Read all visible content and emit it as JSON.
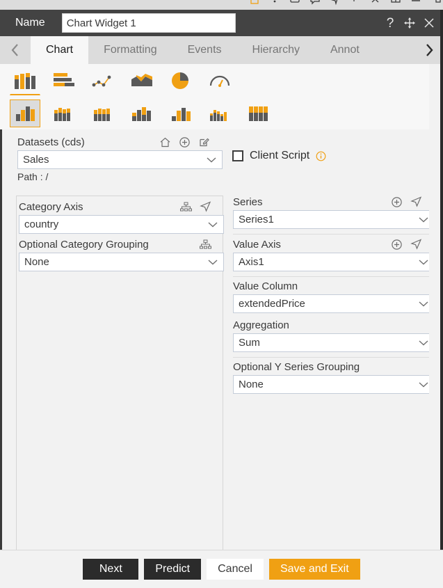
{
  "top_toolbar": {
    "icons": [
      "image-icon",
      "dot-icon",
      "rectangle-icon",
      "callout-icon",
      "arrow-cursor-icon",
      "pointer-icon",
      "scissors-icon",
      "book-icon",
      "lines-icon",
      "panel-icon"
    ]
  },
  "header": {
    "name_label": "Name",
    "name_value": "Chart Widget 1",
    "help_label": "?",
    "move_icon": "move-icon",
    "close_icon": "close-icon"
  },
  "tabbar": {
    "prev_icon": "chevron-left-icon",
    "next_icon": "chevron-right-icon",
    "tabs": [
      {
        "label": "Chart",
        "active": true
      },
      {
        "label": "Formatting",
        "active": false
      },
      {
        "label": "Events",
        "active": false
      },
      {
        "label": "Hierarchy",
        "active": false
      },
      {
        "label": "Annot",
        "active": false
      }
    ]
  },
  "chart_types": {
    "row1": [
      {
        "name": "column-chart-icon",
        "selected": true
      },
      {
        "name": "bar-chart-icon",
        "selected": false
      },
      {
        "name": "line-scatter-chart-icon",
        "selected": false
      },
      {
        "name": "area-chart-icon",
        "selected": false
      },
      {
        "name": "pie-chart-icon",
        "selected": false
      },
      {
        "name": "gauge-chart-icon",
        "selected": false
      }
    ],
    "row2": [
      {
        "name": "clustered-column-icon",
        "selected": true
      },
      {
        "name": "stacked-column-icon",
        "selected": false
      },
      {
        "name": "stacked-column-100-icon",
        "selected": false
      },
      {
        "name": "grouped-column-icon",
        "selected": false
      },
      {
        "name": "mixed-column-icon",
        "selected": false
      },
      {
        "name": "small-multiples-column-icon",
        "selected": false
      },
      {
        "name": "full-stacked-column-icon",
        "selected": false
      }
    ]
  },
  "datasets": {
    "label": "Datasets (cds)",
    "home_icon": "home-icon",
    "add_icon": "plus-circle-icon",
    "edit_icon": "edit-pencil-icon",
    "value": "Sales",
    "path_text": "Path : /"
  },
  "client_script": {
    "label": "Client Script",
    "checked": false,
    "info_icon": "info-icon"
  },
  "category": {
    "axis_label": "Category Axis",
    "axis_value": "country",
    "hierarchy_icon": "hierarchy-icon",
    "navigate_icon": "navigate-icon",
    "grouping_label": "Optional Category Grouping",
    "grouping_value": "None"
  },
  "series": {
    "series_label": "Series",
    "series_value": "Series1",
    "add_icon": "plus-circle-icon",
    "navigate_icon": "navigate-icon",
    "value_axis_label": "Value Axis",
    "value_axis_value": "Axis1",
    "value_column_label": "Value Column",
    "value_column_value": "extendedPrice",
    "aggregation_label": "Aggregation",
    "aggregation_value": "Sum",
    "y_grouping_label": "Optional Y Series Grouping",
    "y_grouping_value": "None"
  },
  "footer": {
    "next": "Next",
    "predict": "Predict",
    "cancel": "Cancel",
    "save_exit": "Save and Exit"
  },
  "colors": {
    "accent": "#f0a013",
    "header_bg": "#434343",
    "tab_bg": "#dcdcdc",
    "body_bg": "#f2f2f2",
    "dark_button": "#2b2b2b"
  }
}
